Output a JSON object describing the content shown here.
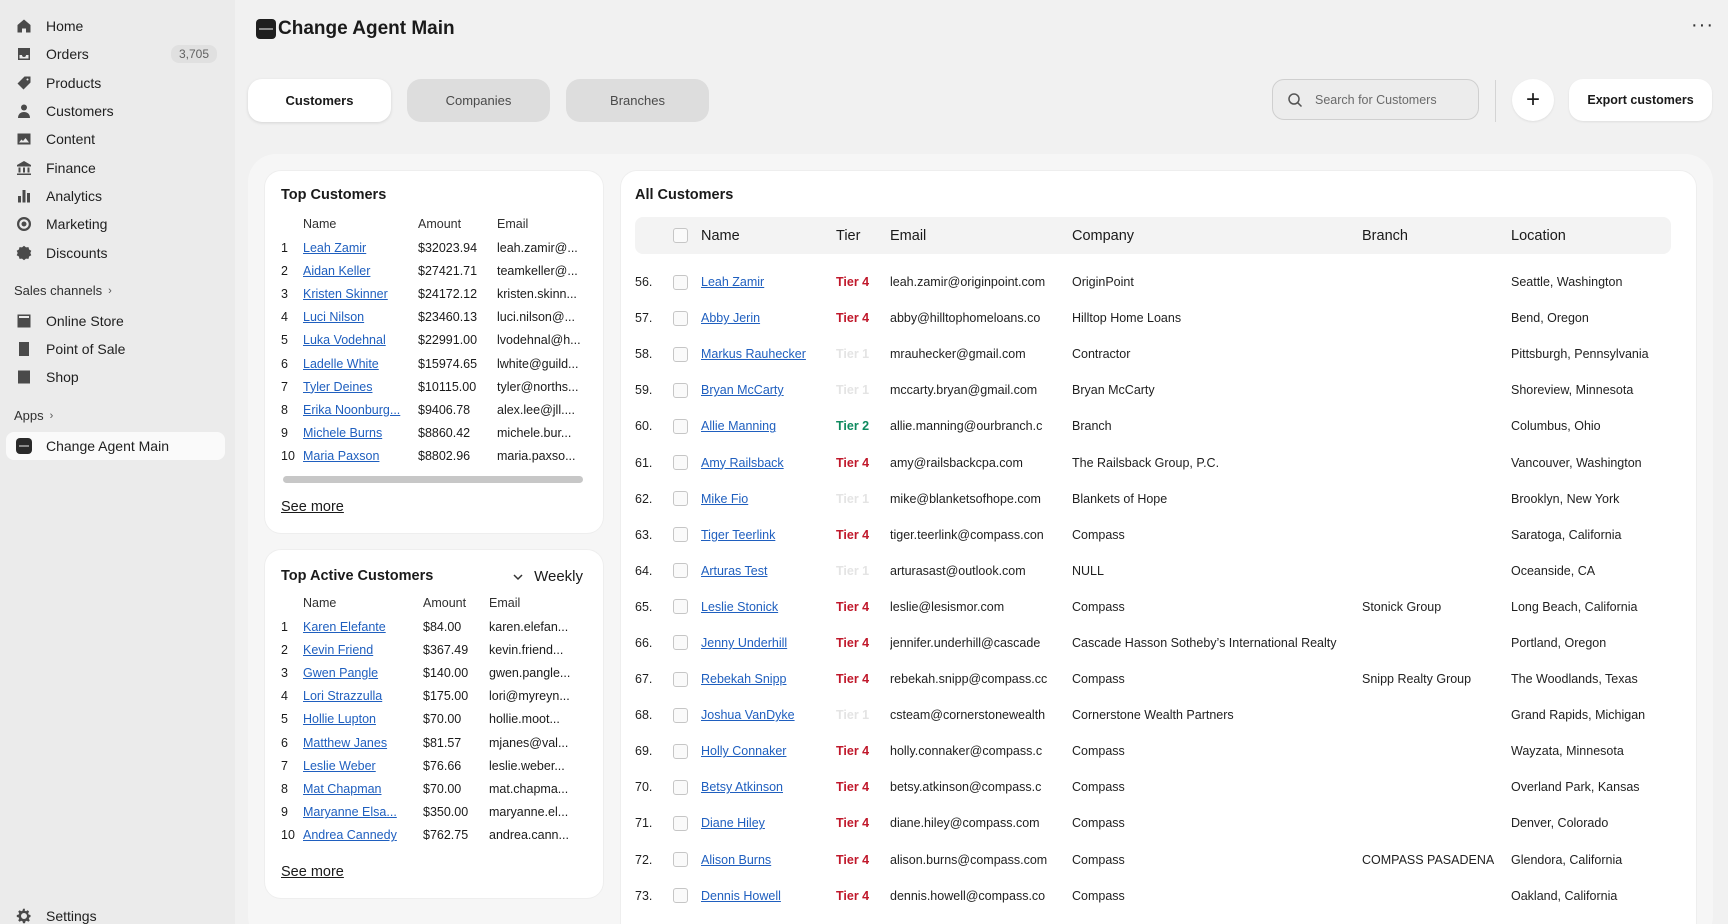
{
  "sidebar": {
    "items": [
      {
        "label": "Home",
        "icon": "home-icon"
      },
      {
        "label": "Orders",
        "icon": "inbox-icon",
        "badge": "3,705"
      },
      {
        "label": "Products",
        "icon": "tag-icon"
      },
      {
        "label": "Customers",
        "icon": "person-icon"
      },
      {
        "label": "Content",
        "icon": "image-icon"
      },
      {
        "label": "Finance",
        "icon": "bank-icon"
      },
      {
        "label": "Analytics",
        "icon": "bar-chart-icon"
      },
      {
        "label": "Marketing",
        "icon": "target-icon"
      },
      {
        "label": "Discounts",
        "icon": "percent-icon"
      }
    ],
    "sales_channels_title": "Sales channels",
    "channels": [
      {
        "label": "Online Store",
        "icon": "store-icon"
      },
      {
        "label": "Point of Sale",
        "icon": "pos-icon"
      },
      {
        "label": "Shop",
        "icon": "shop-icon"
      }
    ],
    "apps_title": "Apps",
    "apps": [
      {
        "label": "Change Agent Main",
        "icon": "app-icon"
      }
    ],
    "settings_label": "Settings"
  },
  "header": {
    "title": "Change Agent Main",
    "more": "···"
  },
  "tabs": [
    {
      "label": "Customers"
    },
    {
      "label": "Companies"
    },
    {
      "label": "Branches"
    }
  ],
  "toolbar": {
    "search_placeholder": "Search for Customers",
    "add_label": "+",
    "export_label": "Export customers"
  },
  "top_customers": {
    "title": "Top Customers",
    "headers": {
      "name": "Name",
      "amount": "Amount",
      "email": "Email"
    },
    "rows": [
      {
        "idx": "1",
        "name": "Leah Zamir",
        "amount": "$32023.94",
        "email": "leah.zamir@..."
      },
      {
        "idx": "2",
        "name": "Aidan Keller",
        "amount": "$27421.71",
        "email": "teamkeller@..."
      },
      {
        "idx": "3",
        "name": "Kristen Skinner",
        "amount": "$24172.12",
        "email": "kristen.skinn..."
      },
      {
        "idx": "4",
        "name": "Luci Nilson",
        "amount": "$23460.13",
        "email": "luci.nilson@..."
      },
      {
        "idx": "5",
        "name": "Luka Vodehnal",
        "amount": "$22991.00",
        "email": "lvodehnal@h..."
      },
      {
        "idx": "6",
        "name": "Ladelle White",
        "amount": "$15974.65",
        "email": "lwhite@guild..."
      },
      {
        "idx": "7",
        "name": "Tyler Deines",
        "amount": "$10115.00",
        "email": "tyler@norths..."
      },
      {
        "idx": "8",
        "name": "Erika Noonburg...",
        "amount": "$9406.78",
        "email": "alex.lee@jll...."
      },
      {
        "idx": "9",
        "name": "Michele Burns",
        "amount": "$8860.42",
        "email": "michele.bur..."
      },
      {
        "idx": "10",
        "name": "Maria Paxson",
        "amount": "$8802.96",
        "email": "maria.paxso..."
      }
    ],
    "see_more": "See more"
  },
  "top_active": {
    "title": "Top Active Customers",
    "period": "Weekly",
    "headers": {
      "name": "Name",
      "amount": "Amount",
      "email": "Email"
    },
    "rows": [
      {
        "idx": "1",
        "name": "Karen Elefante",
        "amount": "$84.00",
        "email": "karen.elefan..."
      },
      {
        "idx": "2",
        "name": "Kevin Friend",
        "amount": "$367.49",
        "email": "kevin.friend..."
      },
      {
        "idx": "3",
        "name": "Gwen Pangle",
        "amount": "$140.00",
        "email": "gwen.pangle..."
      },
      {
        "idx": "4",
        "name": "Lori Strazzulla",
        "amount": "$175.00",
        "email": "lori@myreyn..."
      },
      {
        "idx": "5",
        "name": "Hollie Lupton",
        "amount": "$70.00",
        "email": "hollie.moot..."
      },
      {
        "idx": "6",
        "name": "Matthew Janes",
        "amount": "$81.57",
        "email": "mjanes@val..."
      },
      {
        "idx": "7",
        "name": "Leslie Weber",
        "amount": "$76.66",
        "email": "leslie.weber..."
      },
      {
        "idx": "8",
        "name": "Mat Chapman",
        "amount": "$70.00",
        "email": "mat.chapma..."
      },
      {
        "idx": "9",
        "name": "Maryanne Elsa...",
        "amount": "$350.00",
        "email": "maryanne.el..."
      },
      {
        "idx": "10",
        "name": "Andrea Cannedy",
        "amount": "$762.75",
        "email": "andrea.cann..."
      }
    ],
    "see_more": "See more"
  },
  "all_customers": {
    "title": "All Customers",
    "headers": {
      "name": "Name",
      "tier": "Tier",
      "email": "Email",
      "company": "Company",
      "branch": "Branch",
      "location": "Location"
    },
    "tier_colors": {
      "Tier 4": "#c0182b",
      "Tier 2": "#0f8a5f",
      "Tier 1": "#e4e4e4"
    },
    "rows": [
      {
        "num": "56.",
        "name": "Leah Zamir",
        "tier": "Tier 4",
        "email": "leah.zamir@originpoint.com",
        "company": "OriginPoint",
        "branch": "",
        "location": "Seattle, Washington"
      },
      {
        "num": "57.",
        "name": "Abby Jerin",
        "tier": "Tier 4",
        "email": "abby@hilltophomeloans.co",
        "company": "Hilltop Home Loans",
        "branch": "",
        "location": "Bend, Oregon"
      },
      {
        "num": "58.",
        "name": "Markus Rauhecker",
        "tier": "Tier 1",
        "email": "mrauhecker@gmail.com",
        "company": "Contractor",
        "branch": "",
        "location": "Pittsburgh, Pennsylvania"
      },
      {
        "num": "59.",
        "name": "Bryan McCarty",
        "tier": "Tier 1",
        "email": "mccarty.bryan@gmail.com",
        "company": "Bryan McCarty",
        "branch": "",
        "location": "Shoreview, Minnesota"
      },
      {
        "num": "60.",
        "name": "Allie Manning",
        "tier": "Tier 2",
        "email": "allie.manning@ourbranch.c",
        "company": "Branch",
        "branch": "",
        "location": "Columbus, Ohio"
      },
      {
        "num": "61.",
        "name": "Amy Railsback",
        "tier": "Tier 4",
        "email": "amy@railsbackcpa.com",
        "company": "The Railsback Group, P.C.",
        "branch": "",
        "location": "Vancouver, Washington"
      },
      {
        "num": "62.",
        "name": "Mike Fio",
        "tier": "Tier 1",
        "email": "mike@blanketsofhope.com",
        "company": "Blankets of Hope",
        "branch": "",
        "location": "Brooklyn, New York"
      },
      {
        "num": "63.",
        "name": "Tiger Teerlink",
        "tier": "Tier 4",
        "email": "tiger.teerlink@compass.con",
        "company": "Compass",
        "branch": "",
        "location": "Saratoga, California"
      },
      {
        "num": "64.",
        "name": "Arturas Test",
        "tier": "Tier 1",
        "email": "arturasast@outlook.com",
        "company": "NULL",
        "branch": "",
        "location": "Oceanside, CA"
      },
      {
        "num": "65.",
        "name": "Leslie Stonick",
        "tier": "Tier 4",
        "email": "leslie@lesismor.com",
        "company": "Compass",
        "branch": "Stonick Group",
        "location": "Long Beach, California"
      },
      {
        "num": "66.",
        "name": "Jenny Underhill",
        "tier": "Tier 4",
        "email": "jennifer.underhill@cascade",
        "company": "Cascade Hasson Sotheby’s International Realty",
        "branch": "",
        "location": "Portland, Oregon"
      },
      {
        "num": "67.",
        "name": "Rebekah Snipp",
        "tier": "Tier 4",
        "email": "rebekah.snipp@compass.cc",
        "company": "Compass",
        "branch": "Snipp Realty Group",
        "location": "The Woodlands, Texas"
      },
      {
        "num": "68.",
        "name": "Joshua VanDyke",
        "tier": "Tier 1",
        "email": "csteam@cornerstonewealth",
        "company": "Cornerstone Wealth Partners",
        "branch": "",
        "location": "Grand Rapids, Michigan"
      },
      {
        "num": "69.",
        "name": "Holly Connaker",
        "tier": "Tier 4",
        "email": "holly.connaker@compass.c",
        "company": "Compass",
        "branch": "",
        "location": "Wayzata, Minnesota"
      },
      {
        "num": "70.",
        "name": "Betsy Atkinson",
        "tier": "Tier 4",
        "email": "betsy.atkinson@compass.c",
        "company": "Compass",
        "branch": "",
        "location": "Overland Park, Kansas"
      },
      {
        "num": "71.",
        "name": "Diane Hiley",
        "tier": "Tier 4",
        "email": "diane.hiley@compass.com",
        "company": "Compass",
        "branch": "",
        "location": "Denver, Colorado"
      },
      {
        "num": "72.",
        "name": "Alison Burns",
        "tier": "Tier 4",
        "email": "alison.burns@compass.com",
        "company": "Compass",
        "branch": "COMPASS PASADENA",
        "location": "Glendora, California"
      },
      {
        "num": "73.",
        "name": "Dennis Howell",
        "tier": "Tier 4",
        "email": "dennis.howell@compass.co",
        "company": "Compass",
        "branch": "",
        "location": "Oakland, California"
      }
    ]
  }
}
